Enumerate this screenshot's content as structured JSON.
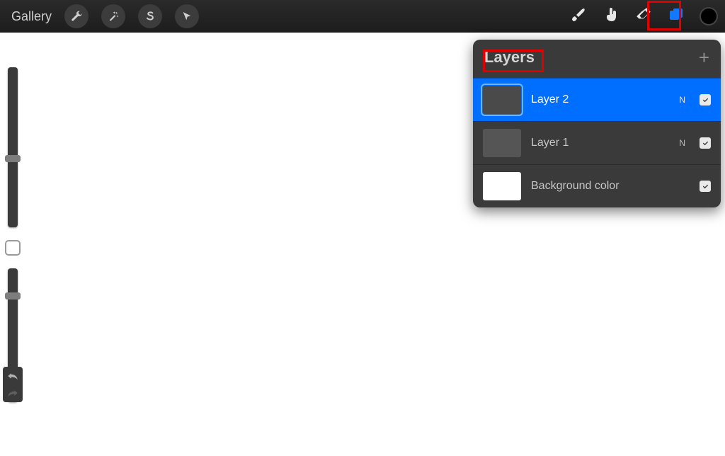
{
  "topbar": {
    "gallery_label": "Gallery",
    "color_swatch_hex": "#000000"
  },
  "layers_panel": {
    "title": "Layers",
    "layers": [
      {
        "name": "Layer 2",
        "blend": "N",
        "visible": true,
        "selected": true,
        "thumb_color": "#4a4a4a"
      },
      {
        "name": "Layer 1",
        "blend": "N",
        "visible": true,
        "selected": false,
        "thumb_color": "#555555"
      }
    ],
    "background": {
      "name": "Background color",
      "visible": true,
      "thumb_color": "#ffffff"
    }
  },
  "colors": {
    "highlight": "#e00000",
    "selection": "#006fff"
  }
}
